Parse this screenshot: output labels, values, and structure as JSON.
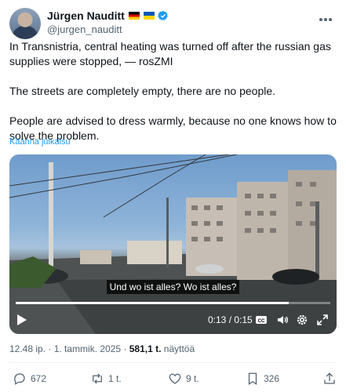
{
  "author": {
    "display_name": "Jürgen Nauditt",
    "handle": "@jurgen_nauditt"
  },
  "tweet": {
    "paragraphs": [
      "In Transnistria, central heating was turned off after the russian gas supplies were stopped, — rosZMI",
      "The streets are completely empty, there are no people.",
      "People are advised to dress warmly, because no one knows how to solve the problem."
    ],
    "translate_label": "Käännä julkaisu"
  },
  "video": {
    "subtitle": "Und wo ist alles? Wo ist alles?",
    "time": "0:13 / 0:15",
    "progress": 0.867
  },
  "meta": {
    "timestamp": "12.48 ip. · 1. tammik. 2025 · ",
    "views_count": "581,1 t.",
    "views_label": " näyttöä"
  },
  "actions": {
    "replies": "672",
    "reposts": "1 t.",
    "likes": "9 t.",
    "bookmarks": "326"
  },
  "colors": {
    "accent": "#1d9bf0",
    "secondary_text": "#536471"
  }
}
